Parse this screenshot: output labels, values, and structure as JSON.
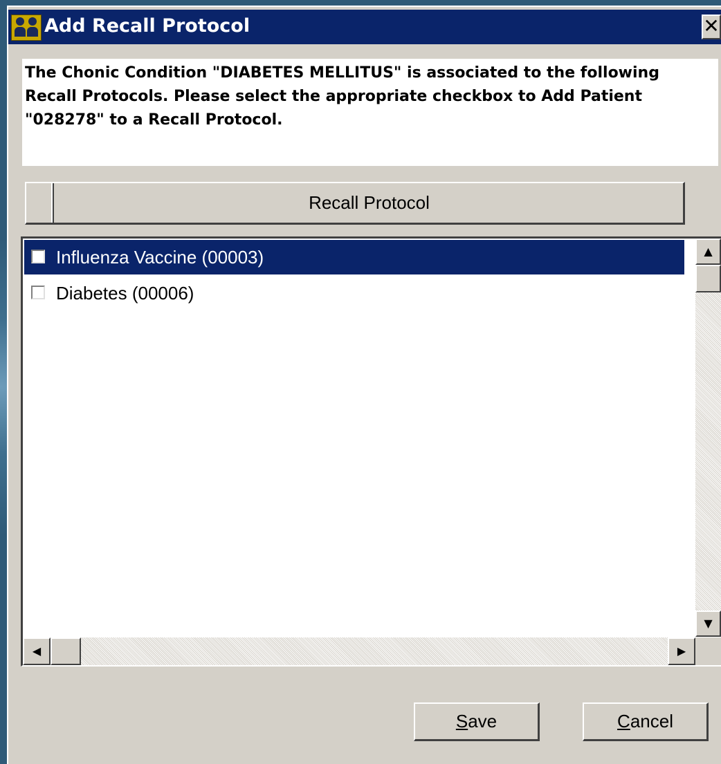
{
  "dialog": {
    "title": "Add Recall Protocol",
    "close_glyph": "✕",
    "message": "The Chonic Condition \"DIABETES MELLITUS\" is associated to the following Recall Protocols. Please select the appropriate checkbox to Add Patient \"028278\" to a Recall Protocol."
  },
  "list": {
    "column_header": "Recall Protocol",
    "items": [
      {
        "label": "Influenza Vaccine (00003)",
        "checked": false,
        "selected": true
      },
      {
        "label": "Diabetes (00006)",
        "checked": false,
        "selected": false
      }
    ]
  },
  "buttons": {
    "save_label": "Save",
    "cancel_label": "Cancel"
  },
  "icons": {
    "app": "patients-group-icon",
    "close": "close-icon"
  }
}
